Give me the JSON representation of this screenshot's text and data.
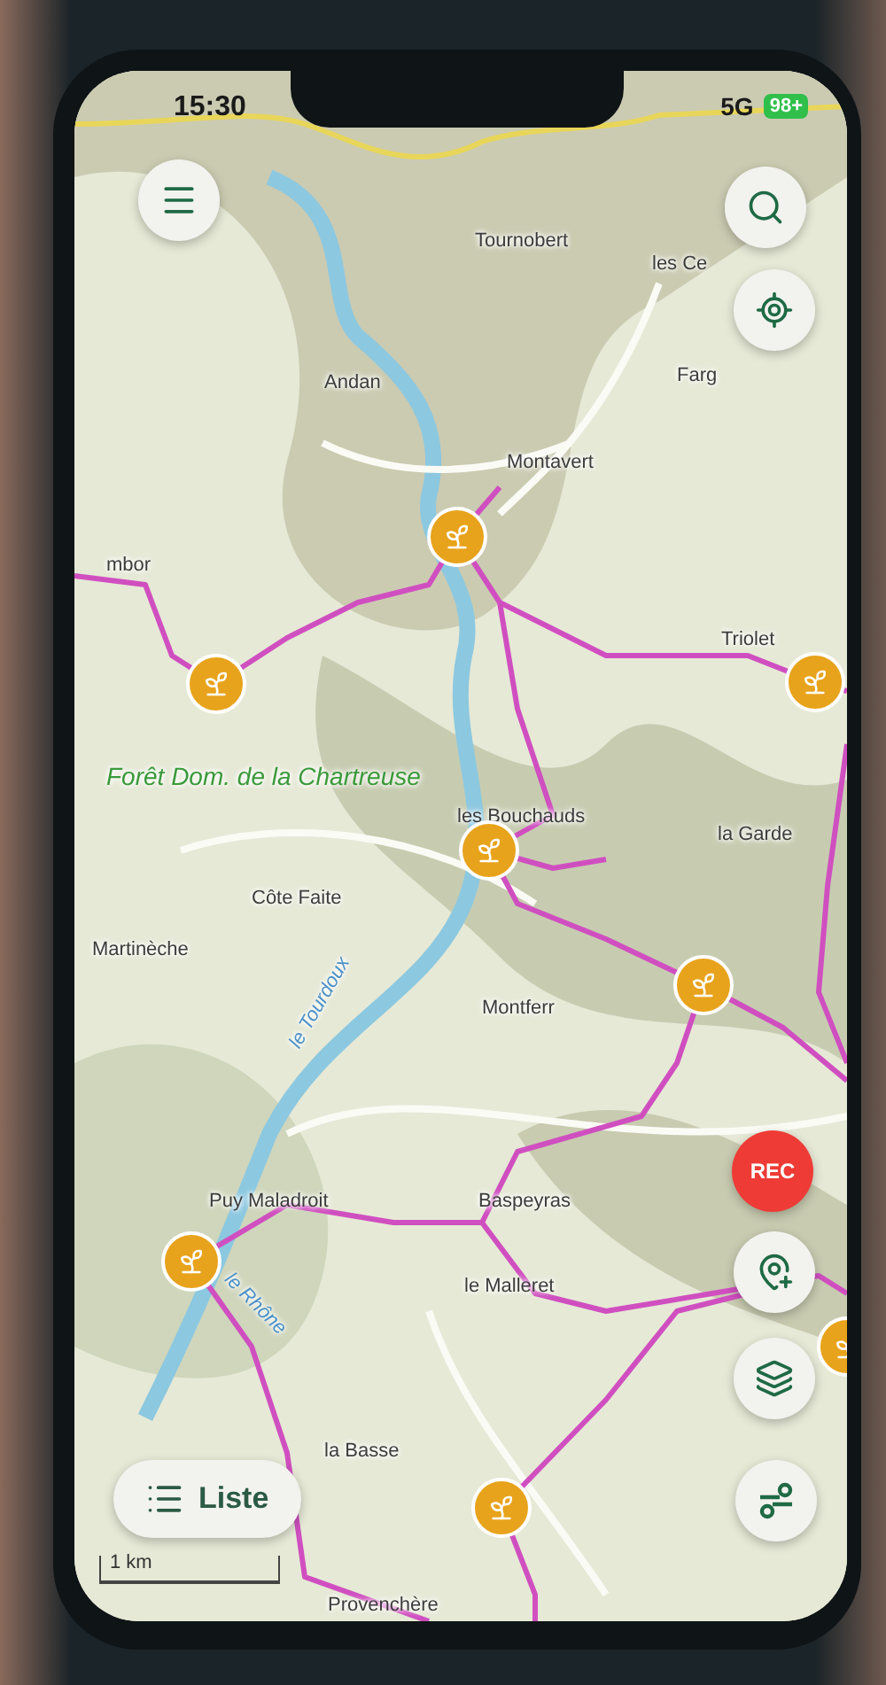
{
  "status_bar": {
    "time": "15:30",
    "network": "5G",
    "battery": "98+"
  },
  "map": {
    "labels": [
      {
        "text": "Tournobert",
        "kind": "place"
      },
      {
        "text": "les Ce",
        "kind": "place"
      },
      {
        "text": "Farg",
        "kind": "place"
      },
      {
        "text": "Andan",
        "kind": "place"
      },
      {
        "text": "Montavert",
        "kind": "place"
      },
      {
        "text": "mbor",
        "kind": "place"
      },
      {
        "text": "Triolet",
        "kind": "place"
      },
      {
        "text": "Forêt Dom. de la Chartreuse",
        "kind": "forest"
      },
      {
        "text": "les Bouchauds",
        "kind": "place"
      },
      {
        "text": "la Garde",
        "kind": "place"
      },
      {
        "text": "Côte Faite",
        "kind": "place"
      },
      {
        "text": "Martinèche",
        "kind": "place"
      },
      {
        "text": "le Tourdoux",
        "kind": "water"
      },
      {
        "text": "Montferr",
        "kind": "place"
      },
      {
        "text": "Puy Maladroit",
        "kind": "place"
      },
      {
        "text": "Baspeyras",
        "kind": "place"
      },
      {
        "text": "le Malleret",
        "kind": "place"
      },
      {
        "text": "le Rhône",
        "kind": "water"
      },
      {
        "text": "la Basse",
        "kind": "place"
      },
      {
        "text": "Provenchère",
        "kind": "place"
      }
    ],
    "scale": "1 km"
  },
  "rec_button": {
    "label": "REC"
  },
  "list_button": {
    "label": "Liste"
  }
}
